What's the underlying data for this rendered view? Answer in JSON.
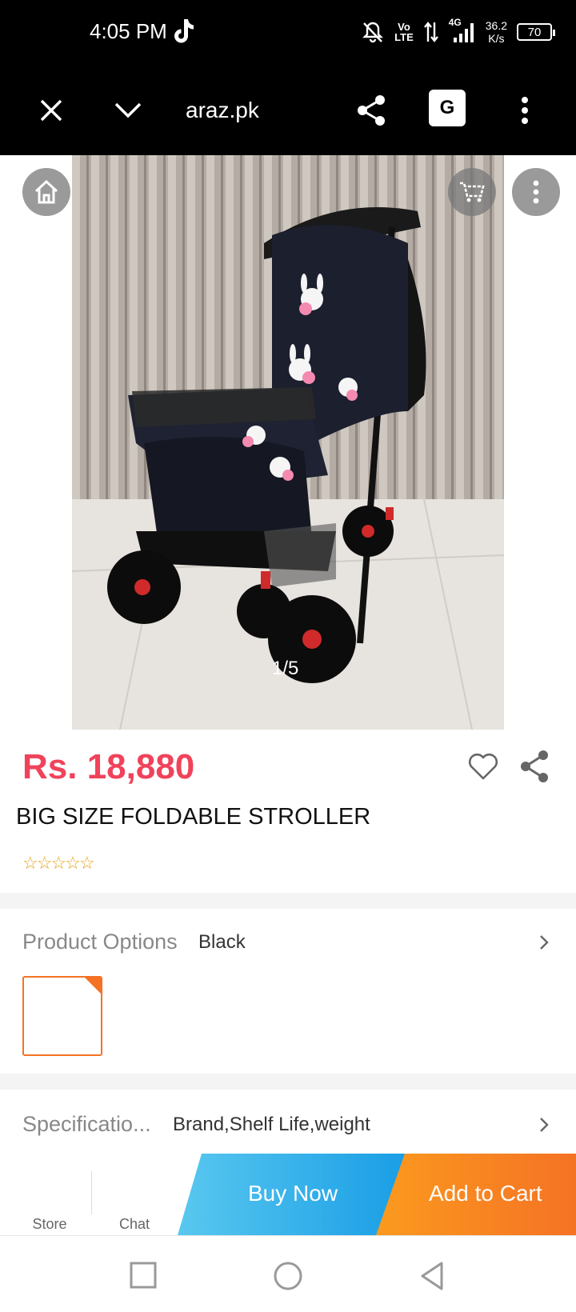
{
  "status_bar": {
    "time": "4:05 PM",
    "volte_top": "Vo",
    "volte_bottom": "LTE",
    "network": "4G",
    "speed_value": "36.2",
    "speed_unit": "K/s",
    "battery": "70"
  },
  "browser_toolbar": {
    "url": "araz.pk",
    "translate_glyph": "G"
  },
  "gallery": {
    "counter": "1/5",
    "image_count": 5,
    "current_index": 1
  },
  "product": {
    "price": "Rs. 18,880",
    "title": "BIG SIZE FOLDABLE STROLLER",
    "rating_stars": "☆☆☆☆☆",
    "rating": 0,
    "rating_max": 5
  },
  "options": {
    "label": "Product Options",
    "value": "Black"
  },
  "specifications": {
    "label": "Specificatio...",
    "value": "Brand,Shelf Life,weight"
  },
  "bottom_bar": {
    "store_label": "Store",
    "chat_label": "Chat",
    "buy_now_label": "Buy Now",
    "add_to_cart_label": "Add to Cart"
  },
  "colors": {
    "price": "#f0435b",
    "buy_now_gradient": [
      "#59c8ef",
      "#1a9ee6"
    ],
    "add_to_cart_gradient": [
      "#fb9a1e",
      "#f57224"
    ],
    "swatch_border": "#f57224",
    "stars": "#e8a317"
  }
}
